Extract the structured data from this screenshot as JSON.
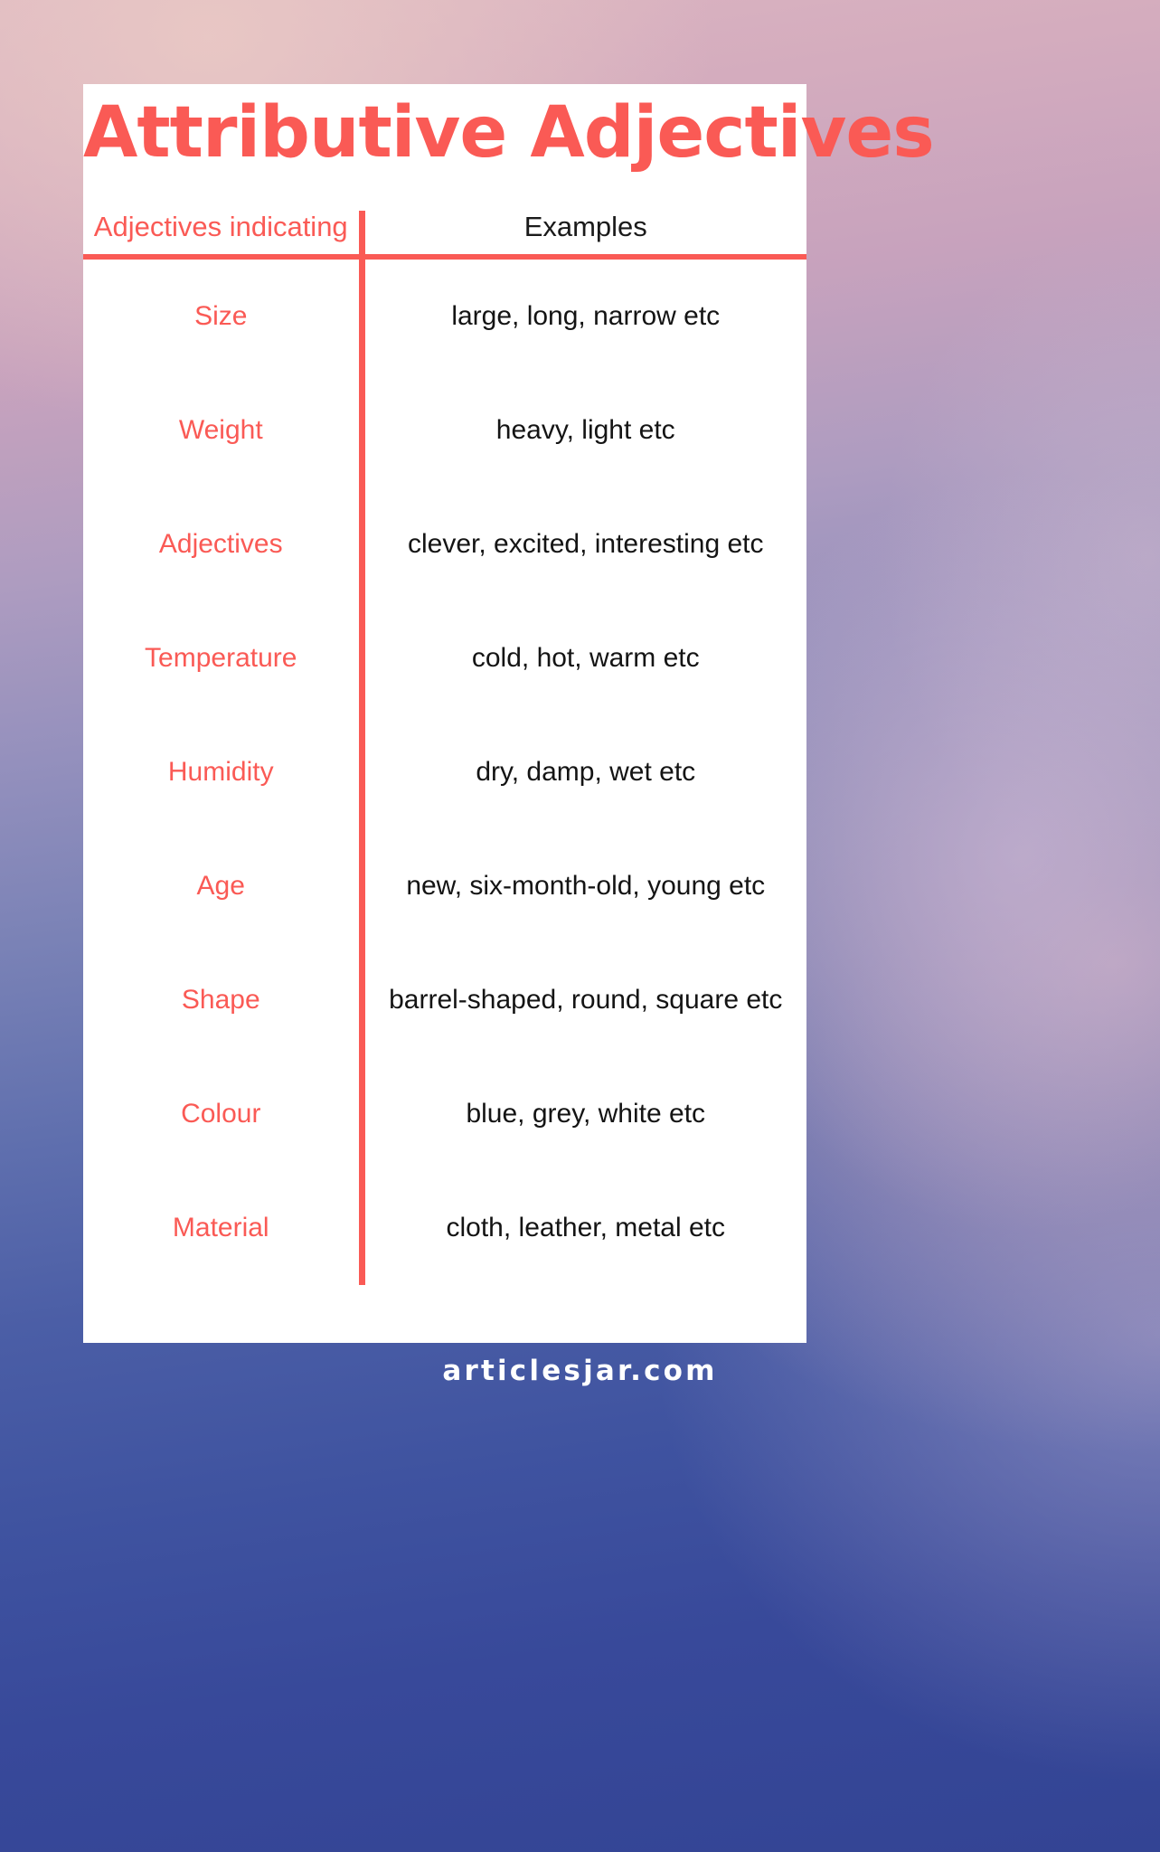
{
  "poster": {
    "title": "Attributive Adjectives",
    "accent_color": "#fa5a55",
    "card_background": "#ffffff",
    "text_color": "#141414"
  },
  "table": {
    "headers": {
      "label": "Adjectives indicating",
      "examples": "Examples"
    },
    "rows": [
      {
        "label": "Size",
        "examples": "large, long, narrow etc"
      },
      {
        "label": "Weight",
        "examples": "heavy, light etc"
      },
      {
        "label": "Adjectives",
        "examples": "clever, excited, interesting etc"
      },
      {
        "label": "Temperature",
        "examples": "cold, hot, warm etc"
      },
      {
        "label": "Humidity",
        "examples": "dry, damp, wet etc"
      },
      {
        "label": "Age",
        "examples": "new, six-month-old, young etc"
      },
      {
        "label": "Shape",
        "examples": "barrel-shaped, round, square etc"
      },
      {
        "label": "Colour",
        "examples": "blue, grey, white etc"
      },
      {
        "label": "Material",
        "examples": "cloth, leather, metal etc"
      }
    ]
  },
  "footer": {
    "site_name": "articlesjar.com",
    "text_color": "#ffffff"
  },
  "background": {
    "top_color": "#dcb6c1",
    "bottom_color": "#334494"
  }
}
